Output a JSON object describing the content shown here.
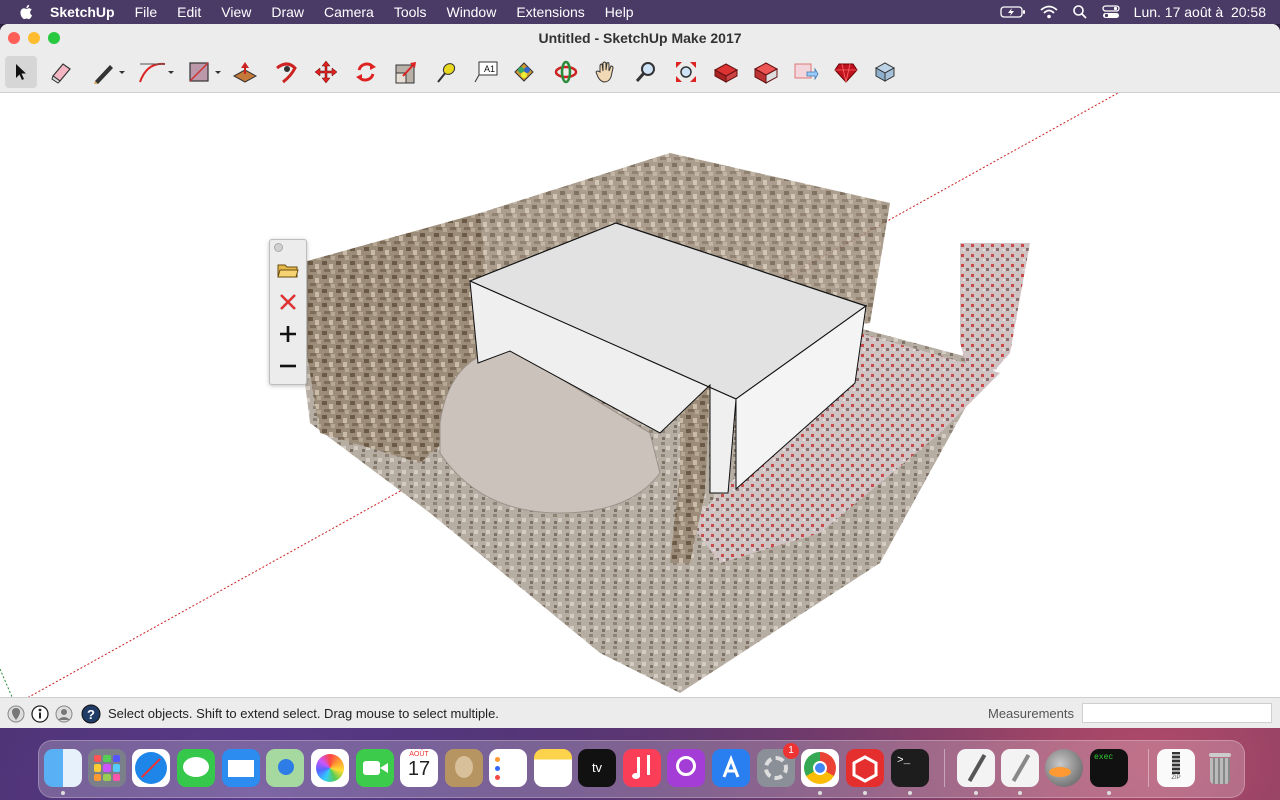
{
  "menubar": {
    "app_name": "SketchUp",
    "items": [
      "File",
      "Edit",
      "View",
      "Draw",
      "Camera",
      "Tools",
      "Window",
      "Extensions",
      "Help"
    ],
    "datetime": "Lun. 17 août à  20:58"
  },
  "window": {
    "title": "Untitled - SketchUp Make 2017"
  },
  "toolbar": {
    "tools": [
      "select-tool",
      "eraser-tool",
      "line-tool",
      "arc-tool",
      "rectangle-tool",
      "push-pull-tool",
      "follow-me-tool",
      "move-tool",
      "rotate-tool",
      "scale-tool",
      "tape-measure-tool",
      "text-tool",
      "paint-bucket-tool",
      "orbit-tool",
      "pan-tool",
      "zoom-tool",
      "zoom-extents-tool",
      "3d-warehouse-tool",
      "extension-warehouse-tool",
      "layout-tool",
      "extension-manager-tool",
      "section-tool"
    ],
    "text_tool_label": "A1"
  },
  "palette": {
    "buttons": [
      "open-folder",
      "delete",
      "add",
      "remove"
    ]
  },
  "statusbar": {
    "hint": "Select objects. Shift to extend select. Drag mouse to select multiple.",
    "measurements_label": "Measurements",
    "measurements_value": ""
  },
  "dock": {
    "calendar_month": "AOÛT",
    "calendar_day": "17",
    "appletv_label": "tv",
    "settings_badge": "1",
    "terminal_label": ">_",
    "exec_label": "exec",
    "zip_label": "ZIP"
  },
  "colors": {
    "menubar_bg": "#4a3a66",
    "close": "#ff5f57",
    "minimize": "#febc2e",
    "zoom": "#28c840",
    "axis_red": "#cc2222"
  }
}
